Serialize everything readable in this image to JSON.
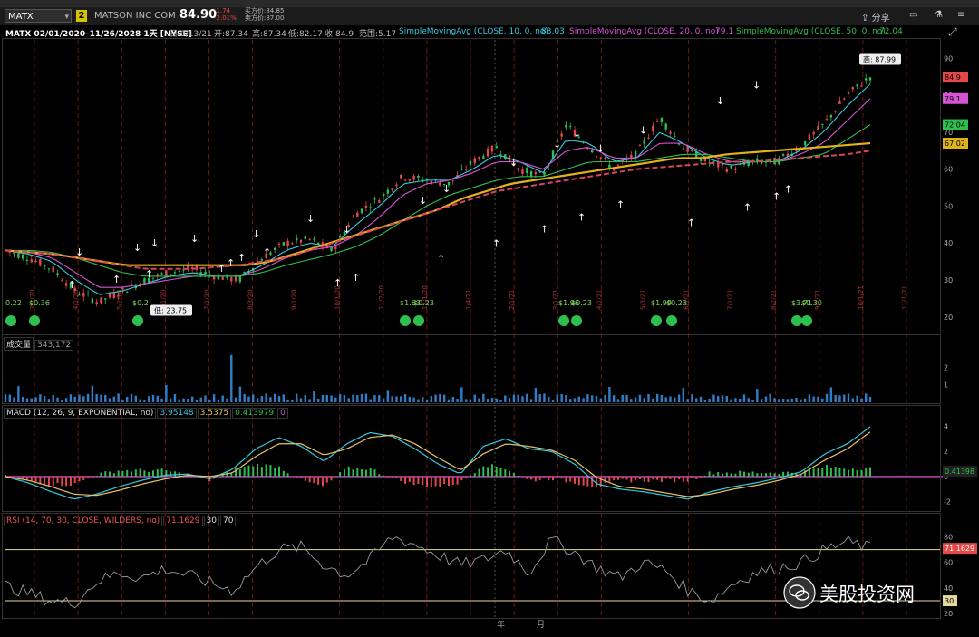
{
  "toolbar": {
    "symbol": "MATX",
    "link_badge": "2",
    "company": "MATSON INC COM",
    "last": "84.90",
    "change": "-1.74",
    "change_pct": "-2.01%",
    "bid": "买方价:84.85",
    "ask": "卖方价:87.00",
    "share_label": "分享"
  },
  "info": {
    "title": "MATX 02/01/2020–11/26/2028 1天 [NYSE]",
    "date": "日:9/13/21",
    "open": "开:87.34",
    "high": "高:87.34",
    "low": "低:82.17",
    "close": "收:84.9",
    "range": "范围:5.17",
    "sma10_label": "SimpleMovingAvg (CLOSE, 10, 0, no)",
    "sma10_val": "83.03",
    "sma20_label": "SimpleMovingAvg (CLOSE, 20, 0, no)",
    "sma20_val": "79.1",
    "sma50_label": "SimpleMovingAvg (CLOSE, 50, 0, no)",
    "sma50_val": "72.04"
  },
  "chart_data": [
    {
      "type": "line",
      "title": "MATX 02/01/2020–11/26/2028 1天 [NYSE]",
      "pane": "price",
      "ylim": [
        17,
        94
      ],
      "y_ticks": [
        20,
        30,
        40,
        50,
        60,
        70,
        80,
        90
      ],
      "x_tick_labels": [
        "3/2/20",
        "4/1/20",
        "5/1/20",
        "6/1/20",
        "7/1/20",
        "8/3/20",
        "9/1/20",
        "10/1/20",
        "11/2/20",
        "12/1/20",
        "1/4/21",
        "2/1/21",
        "3/1/21",
        "4/1/21",
        "5/3/21",
        "6/1/21",
        "7/1/21",
        "8/2/21",
        "9/1/21",
        "10/1/21",
        "11/1/21"
      ],
      "series": [
        {
          "name": "MATX",
          "values": [
            38,
            36,
            33,
            27,
            24,
            27,
            30,
            32,
            33,
            31,
            30,
            36,
            40,
            41,
            38,
            48,
            52,
            58,
            57,
            56,
            62,
            66,
            60,
            58,
            72,
            66,
            60,
            64,
            74,
            66,
            62,
            60,
            62,
            62,
            66,
            72,
            80,
            85
          ]
        },
        {
          "name": "SimpleMovingAvg (CLOSE, 10, 0, no)",
          "values": [
            38,
            37,
            35,
            30,
            26,
            27,
            29,
            31,
            32,
            31,
            31,
            34,
            38,
            40,
            39,
            45,
            50,
            56,
            57,
            57,
            60,
            64,
            62,
            59,
            68,
            67,
            62,
            63,
            70,
            67,
            63,
            61,
            62,
            62,
            65,
            70,
            77,
            83.03
          ]
        },
        {
          "name": "SimpleMovingAvg (CLOSE, 20, 0, no)",
          "values": [
            38,
            37.5,
            36,
            32,
            28,
            28,
            29,
            30,
            31,
            31,
            31,
            33,
            36,
            38,
            39,
            42,
            47,
            53,
            56,
            57,
            59,
            62,
            62,
            60,
            65,
            66,
            63,
            63,
            67,
            67,
            64,
            62,
            62,
            62,
            64,
            67,
            73,
            79.1
          ]
        },
        {
          "name": "SimpleMovingAvg (CLOSE, 50, 0, no)",
          "values": [
            38,
            38,
            37.5,
            36,
            34,
            32,
            31,
            31,
            31,
            31,
            31,
            32,
            34,
            35.5,
            37,
            39,
            42,
            46,
            50,
            53,
            55,
            57,
            58,
            58,
            60,
            62,
            62,
            62,
            63,
            64,
            64,
            63,
            62,
            62,
            63,
            64,
            68,
            72.04
          ]
        }
      ],
      "price_labels": [
        {
          "text": "84.9",
          "value": 84.9,
          "color": "#e54848"
        },
        {
          "text": "79.1",
          "value": 79.1,
          "color": "#d455d4"
        },
        {
          "text": "72.04",
          "value": 72.04,
          "color": "#2fbf4f"
        },
        {
          "text": "67.02",
          "value": 67.02,
          "color": "#e0b21c"
        }
      ],
      "annotations": {
        "high": "高: 87.99",
        "low": "低: 23.75",
        "dividends": [
          "0.22",
          "$0.36",
          "$0.2",
          "$1.63",
          "$0.23",
          "$1.96",
          "$0.23",
          "$1.99",
          "$0.23",
          "$3.71",
          "$0.30"
        ],
        "year_marker": "年"
      }
    },
    {
      "type": "bar",
      "pane": "volume",
      "title": "成交量",
      "last_volume": "343,172",
      "y_ticks": [
        1,
        2
      ],
      "ylim": [
        0,
        3
      ]
    },
    {
      "type": "line",
      "pane": "macd",
      "title": "MACD (12, 26, 9, EXPONENTIAL, no)",
      "values_shown": [
        "3.95148",
        "3.5375",
        "0.413979",
        "0"
      ],
      "last_label": "0.41398",
      "ylim": [
        -2.6,
        4.6
      ],
      "y_ticks": [
        4,
        2,
        0,
        -2
      ],
      "series": [
        {
          "name": "Value",
          "values": [
            0,
            -0.5,
            -1.2,
            -1.8,
            -1.4,
            -0.8,
            -0.3,
            0.1,
            0.2,
            -0.2,
            0.6,
            2.2,
            3.1,
            2.4,
            1.2,
            2.6,
            3.5,
            3.2,
            2.2,
            1.0,
            0.2,
            2.4,
            3.0,
            2.2,
            2.0,
            1.0,
            -0.6,
            -1.0,
            -1.2,
            -1.5,
            -1.8,
            -1.2,
            -0.8,
            -0.5,
            -0.1,
            0.4,
            1.8,
            2.6,
            3.95
          ]
        },
        {
          "name": "Avg",
          "values": [
            0,
            -0.3,
            -0.8,
            -1.4,
            -1.5,
            -1.1,
            -0.6,
            -0.2,
            0.1,
            0,
            0.3,
            1.6,
            2.6,
            2.6,
            1.7,
            2.2,
            3.1,
            3.3,
            2.6,
            1.5,
            0.5,
            1.8,
            2.6,
            2.4,
            2.1,
            1.3,
            -0.1,
            -0.8,
            -1.0,
            -1.3,
            -1.6,
            -1.4,
            -1.0,
            -0.7,
            -0.3,
            0.2,
            1.3,
            2.2,
            3.54
          ]
        }
      ]
    },
    {
      "type": "line",
      "pane": "rsi",
      "title": "RSI (14, 70, 30, CLOSE, WILDERS, no)",
      "values_shown": [
        "71.1629",
        "30",
        "70"
      ],
      "last_label": "71.1629",
      "ylim": [
        18,
        86
      ],
      "y_ticks": [
        80,
        60,
        40,
        20
      ],
      "series": [
        {
          "name": "RSI",
          "values": [
            42,
            36,
            30,
            28,
            45,
            52,
            48,
            55,
            50,
            44,
            38,
            56,
            70,
            72,
            58,
            50,
            62,
            80,
            74,
            66,
            58,
            62,
            70,
            52,
            78,
            68,
            56,
            48,
            60,
            54,
            38,
            30,
            44,
            52,
            56,
            60,
            70,
            76,
            71.16
          ]
        }
      ]
    }
  ],
  "watermark": "美股投资网",
  "month_label": "月"
}
